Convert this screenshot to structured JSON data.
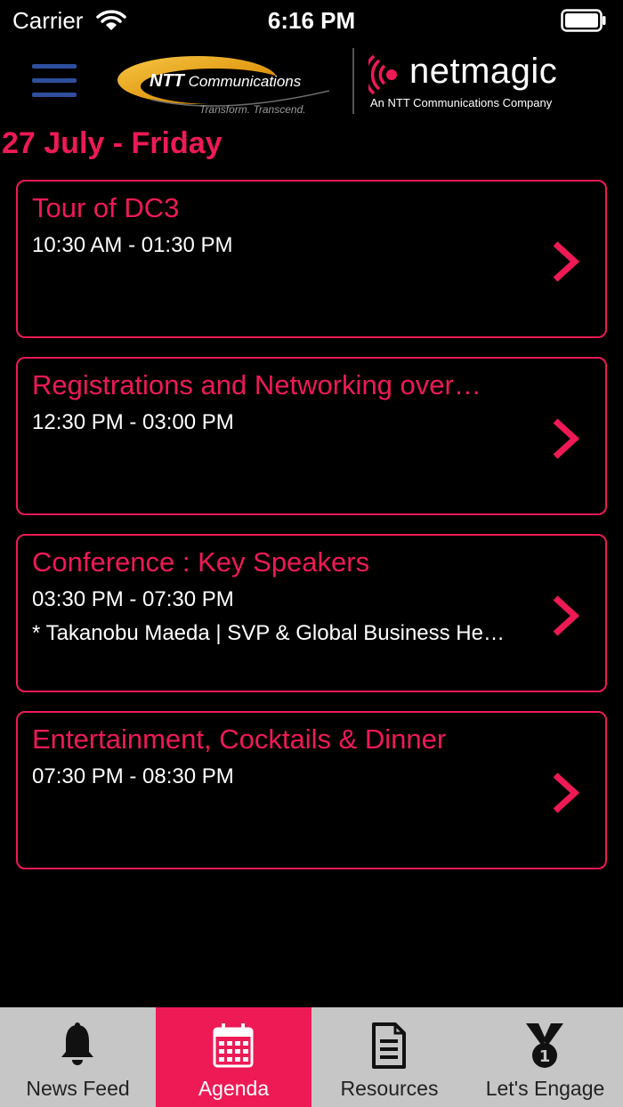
{
  "status_bar": {
    "carrier": "Carrier",
    "time": "6:16 PM"
  },
  "header": {
    "ntt_brand": "NTT",
    "ntt_word": "Communications",
    "ntt_tagline": "Transform. Transcend.",
    "netmagic_word": "netmagic",
    "netmagic_sub": "An NTT Communications Company"
  },
  "date_heading": "27 July - Friday",
  "agenda": [
    {
      "title": "Tour of DC3",
      "time": "10:30 AM - 01:30 PM",
      "description": ""
    },
    {
      "title": "Registrations and Networking over…",
      "time": "12:30 PM - 03:00 PM",
      "description": ""
    },
    {
      "title": "Conference : Key Speakers",
      "time": "03:30 PM - 07:30 PM",
      "description": "* Takanobu Maeda | SVP & Global Business He…"
    },
    {
      "title": "Entertainment, Cocktails & Dinner",
      "time": "07:30 PM - 08:30 PM",
      "description": ""
    }
  ],
  "tabs": [
    {
      "label": "News Feed",
      "icon": "bell-icon",
      "active": false
    },
    {
      "label": "Agenda",
      "icon": "calendar-icon",
      "active": true
    },
    {
      "label": "Resources",
      "icon": "document-icon",
      "active": false
    },
    {
      "label": "Let's Engage",
      "icon": "medal-icon",
      "active": false
    }
  ],
  "colors": {
    "accent": "#ee1a55",
    "background": "#000000",
    "tab_bar": "#c6c6c6",
    "menu_icon": "#2d4f9c"
  }
}
